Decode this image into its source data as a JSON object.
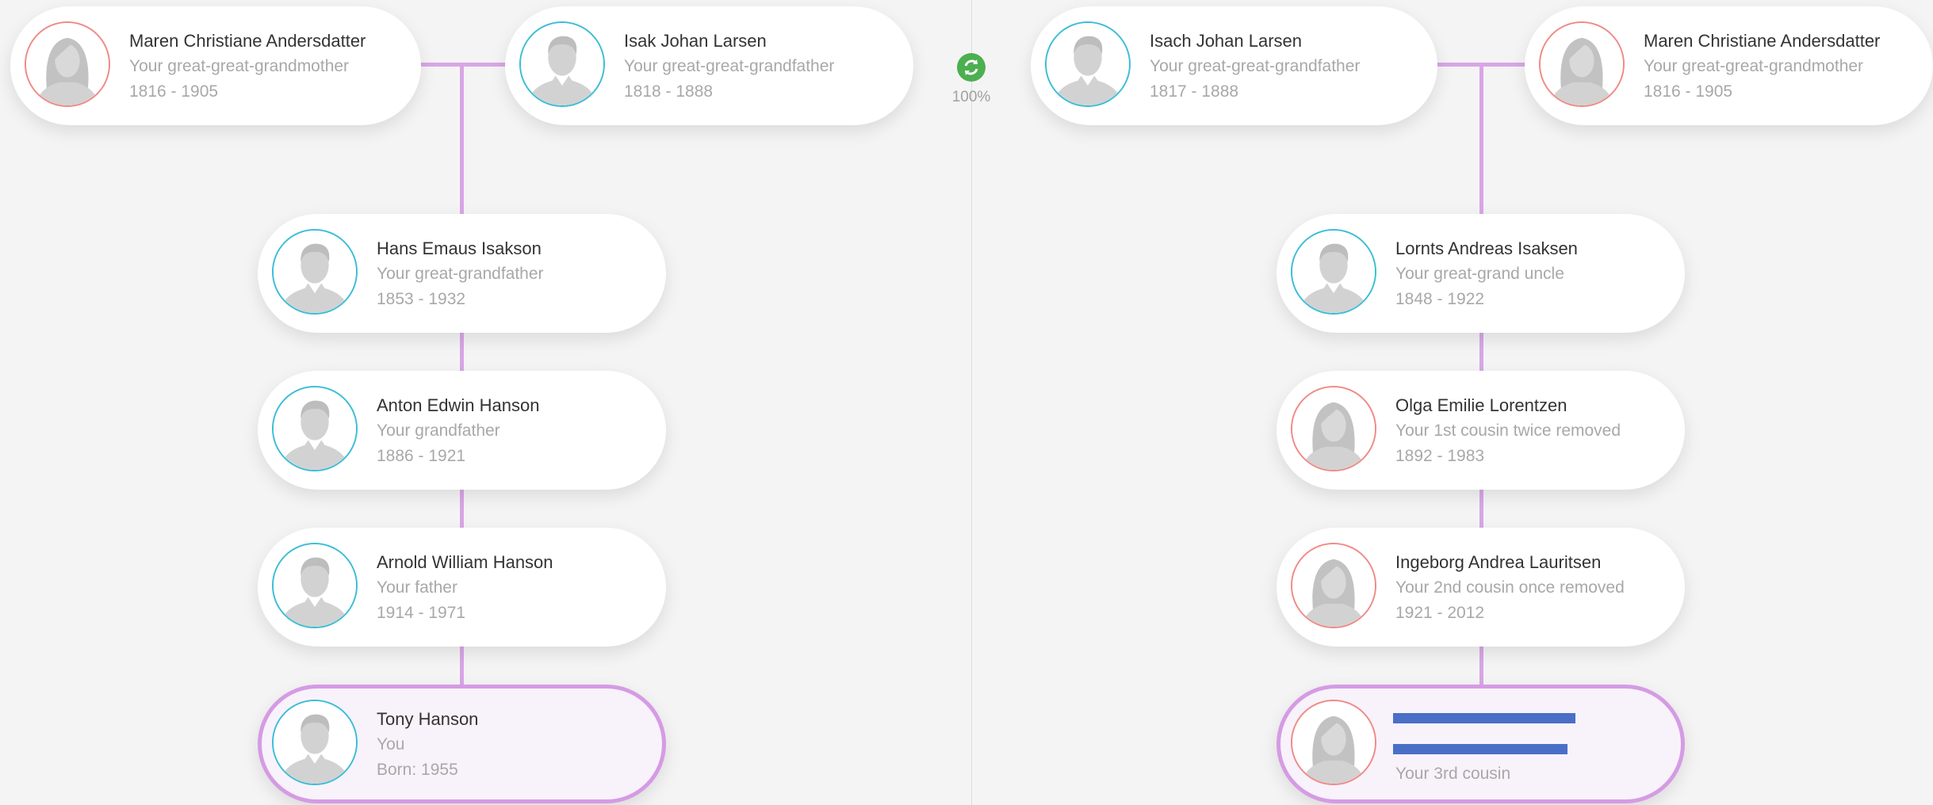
{
  "toolbar": {
    "zoom": "100%",
    "sync_icon": "refresh-icon"
  },
  "colors": {
    "line": "#d8a6e6",
    "male": "#3bbdd6",
    "female": "#ef8a86",
    "self_border": "#d59be4",
    "sync": "#4caf50"
  },
  "left": {
    "gg_mother": {
      "name": "Maren Christiane Andersdatter",
      "relation": "Your great-great-grandmother",
      "years": "1816 - 1905"
    },
    "gg_father": {
      "name": "Isak Johan Larsen",
      "relation": "Your great-great-grandfather",
      "years": "1818 - 1888"
    },
    "g_father": {
      "name": "Hans Emaus Isakson",
      "relation": "Your great-grandfather",
      "years": "1853 - 1932"
    },
    "grandfather": {
      "name": "Anton Edwin Hanson",
      "relation": "Your grandfather",
      "years": "1886 - 1921"
    },
    "father": {
      "name": "Arnold William Hanson",
      "relation": "Your father",
      "years": "1914 - 1971"
    },
    "self": {
      "name": "Tony Hanson",
      "relation": "You",
      "years": "Born: 1955"
    }
  },
  "right": {
    "gg_father": {
      "name": "Isach Johan Larsen",
      "relation": "Your great-great-grandfather",
      "years": "1817 - 1888"
    },
    "gg_mother": {
      "name": "Maren Christiane Andersdatter",
      "relation": "Your great-great-grandmother",
      "years": "1816 - 1905"
    },
    "uncle": {
      "name": "Lornts Andreas Isaksen",
      "relation": "Your great-grand uncle",
      "years": "1848 - 1922"
    },
    "cousin1": {
      "name": "Olga Emilie Lorentzen",
      "relation": "Your 1st cousin twice removed",
      "years": "1892 - 1983"
    },
    "cousin2": {
      "name": "Ingeborg Andrea Lauritsen",
      "relation": "Your 2nd cousin once removed",
      "years": "1921 - 2012"
    },
    "cousin3": {
      "relation": "Your 3rd cousin"
    }
  }
}
